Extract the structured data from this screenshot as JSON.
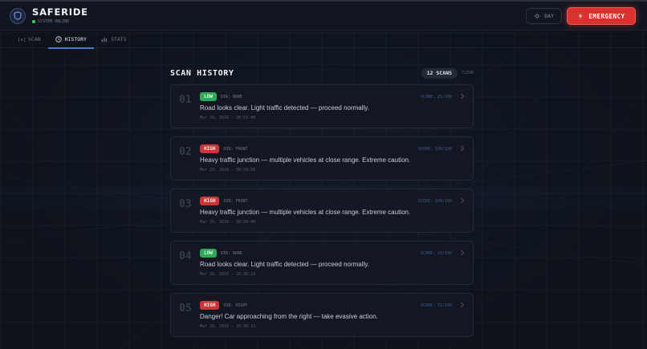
{
  "app": {
    "title": "SAFERIDE",
    "status": "SYSTEM ONLINE",
    "day_toggle": "DAY",
    "emergency": "EMERGENCY"
  },
  "tabs": [
    {
      "label": "SCAN",
      "icon": "radar-icon"
    },
    {
      "label": "HISTORY",
      "icon": "clock-icon",
      "active": true
    },
    {
      "label": "STATS",
      "icon": "bar-chart-icon"
    }
  ],
  "history": {
    "title": "SCAN HISTORY",
    "count": "12 SCANS",
    "clear": "CLEAR",
    "items": [
      {
        "num": "01",
        "level": "LOW",
        "dir": "DIR: NONE",
        "score": "SCORE: 25/100",
        "message": "Road looks clear. Light traffic detected — proceed normally.",
        "time": "Mar 29, 2026 — 00:51:40"
      },
      {
        "num": "02",
        "level": "HIGH",
        "dir": "DIR: FRONT",
        "score": "SCORE: 100/100",
        "message": "Heavy traffic junction — multiple vehicles at close range. Extreme caution.",
        "time": "Mar 29, 2026 — 00:50:56"
      },
      {
        "num": "03",
        "level": "HIGH",
        "dir": "DIR: FRONT",
        "score": "SCORE: 100/100",
        "message": "Heavy traffic junction — multiple vehicles at close range. Extreme caution.",
        "time": "Mar 29, 2026 — 00:50:46"
      },
      {
        "num": "04",
        "level": "LOW",
        "dir": "DIR: NONE",
        "score": "SCORE: 25/100",
        "message": "Road looks clear. Light traffic detected — proceed normally.",
        "time": "Mar 28, 2026 — 20:36:29"
      },
      {
        "num": "05",
        "level": "HIGH",
        "dir": "DIR: RIGHT",
        "score": "SCORE: 55/100",
        "message": "Danger! Car approaching from the right — take evasive action.",
        "time": "Mar 28, 2026 — 20:36:22"
      }
    ]
  },
  "colors": {
    "accent": "#4c78c4",
    "emergency": "#d9322f",
    "low": "#2fa85a",
    "high": "#c8363a",
    "background": "#0e131d"
  }
}
